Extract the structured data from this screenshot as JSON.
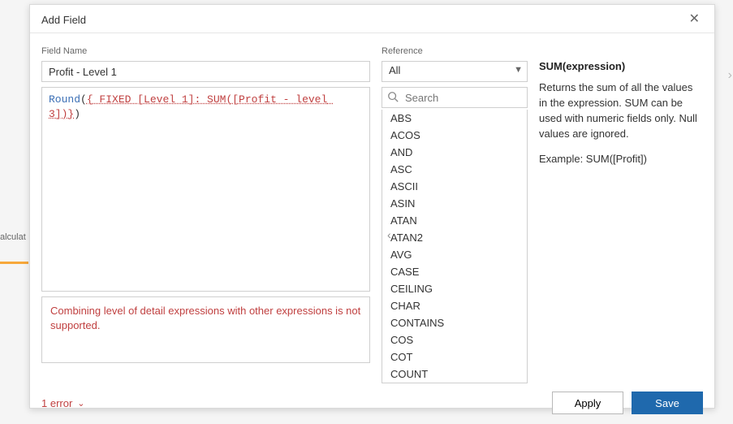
{
  "bgLabel": "alculat",
  "title": "Add Field",
  "fieldNameLabel": "Field Name",
  "fieldNameValue": "Profit - Level 1",
  "formula": {
    "fn": "Round",
    "openParen": "(",
    "errorPart": "{ FIXED [Level 1]: SUM([Profit - level 3])}",
    "closeParen": ")"
  },
  "errorMessage": "Combining level of detail expressions with other expressions is not supported.",
  "errorCount": "1 error",
  "referenceLabel": "Reference",
  "referenceValue": "All",
  "searchPlaceholder": "Search",
  "functions": [
    "ABS",
    "ACOS",
    "AND",
    "ASC",
    "ASCII",
    "ASIN",
    "ATAN",
    "ATAN2",
    "AVG",
    "CASE",
    "CEILING",
    "CHAR",
    "CONTAINS",
    "COS",
    "COT",
    "COUNT"
  ],
  "help": {
    "title": "SUM(expression)",
    "desc": "Returns the sum of all the values in the expression. SUM can be used with numeric fields only. Null values are ignored.",
    "example": "Example: SUM([Profit])"
  },
  "buttons": {
    "apply": "Apply",
    "save": "Save"
  }
}
